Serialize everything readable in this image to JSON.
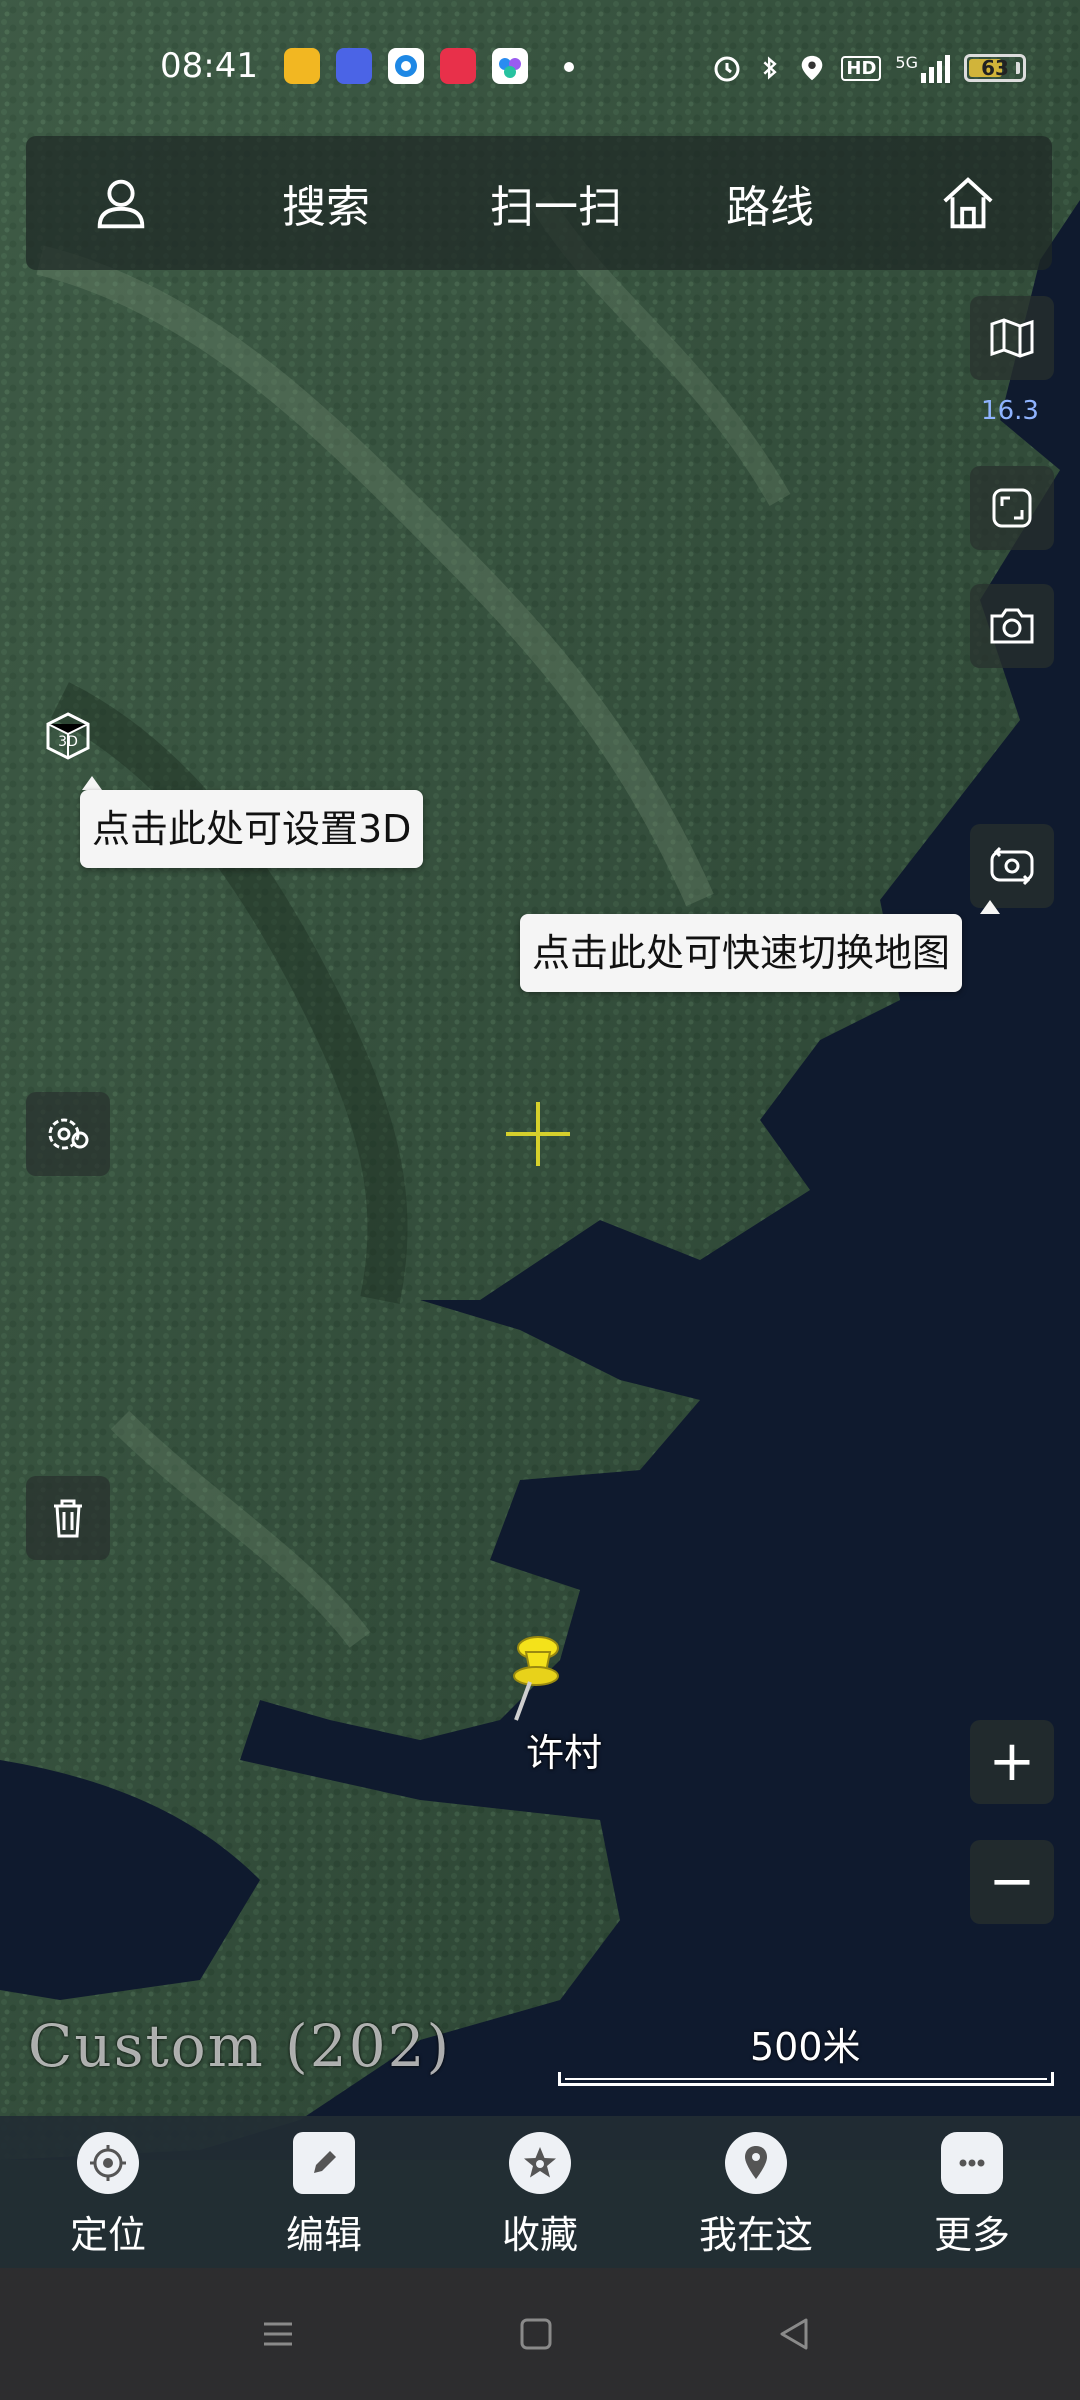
{
  "status_bar": {
    "time": "08:41",
    "network": "5G",
    "hd": "HD",
    "battery": "63",
    "battery_level": 0.63,
    "icons": [
      "alarm-icon",
      "bluetooth-icon",
      "location-icon",
      "hd-icon",
      "signal-icon",
      "battery-icon"
    ],
    "app_icons": [
      "amap-app-icon",
      "tieba-app-icon",
      "browser-app-icon",
      "weibo-app-icon",
      "cloud-app-icon"
    ]
  },
  "top_nav": {
    "profile_icon": "user-icon",
    "search": "搜索",
    "scan": "扫一扫",
    "route": "路线",
    "home_icon": "home-icon"
  },
  "right_controls": {
    "layers_icon": "map-layers-icon",
    "zoom_level": "16.3",
    "fullscreen_icon": "fullscreen-icon",
    "screenshot_icon": "camera-icon",
    "switch_map_icon": "switch-camera-icon",
    "zoom_in": "+",
    "zoom_out": "−"
  },
  "left_controls": {
    "three_d_icon": "3d-cube-icon",
    "settings_icon": "settings-gear-icon",
    "delete_icon": "trash-icon"
  },
  "tooltips": {
    "three_d": "点击此处可设置3D",
    "switch_map": "点击此处可快速切换地图"
  },
  "map": {
    "marker_label": "许村",
    "source_label": "Custom (202)",
    "scale_label": "500米",
    "colors": {
      "water": "#0f1a2e",
      "forest": "#2f4a38",
      "forest_light": "#4f6b52",
      "crosshair": "#d6d02c",
      "pin": "#f4e21a"
    }
  },
  "bottom_bar": {
    "items": [
      {
        "label": "定位",
        "icon": "locate-target-icon"
      },
      {
        "label": "编辑",
        "icon": "edit-pencil-icon"
      },
      {
        "label": "收藏",
        "icon": "favorite-star-icon"
      },
      {
        "label": "我在这",
        "icon": "location-pin-icon"
      },
      {
        "label": "更多",
        "icon": "more-dots-icon"
      }
    ]
  }
}
